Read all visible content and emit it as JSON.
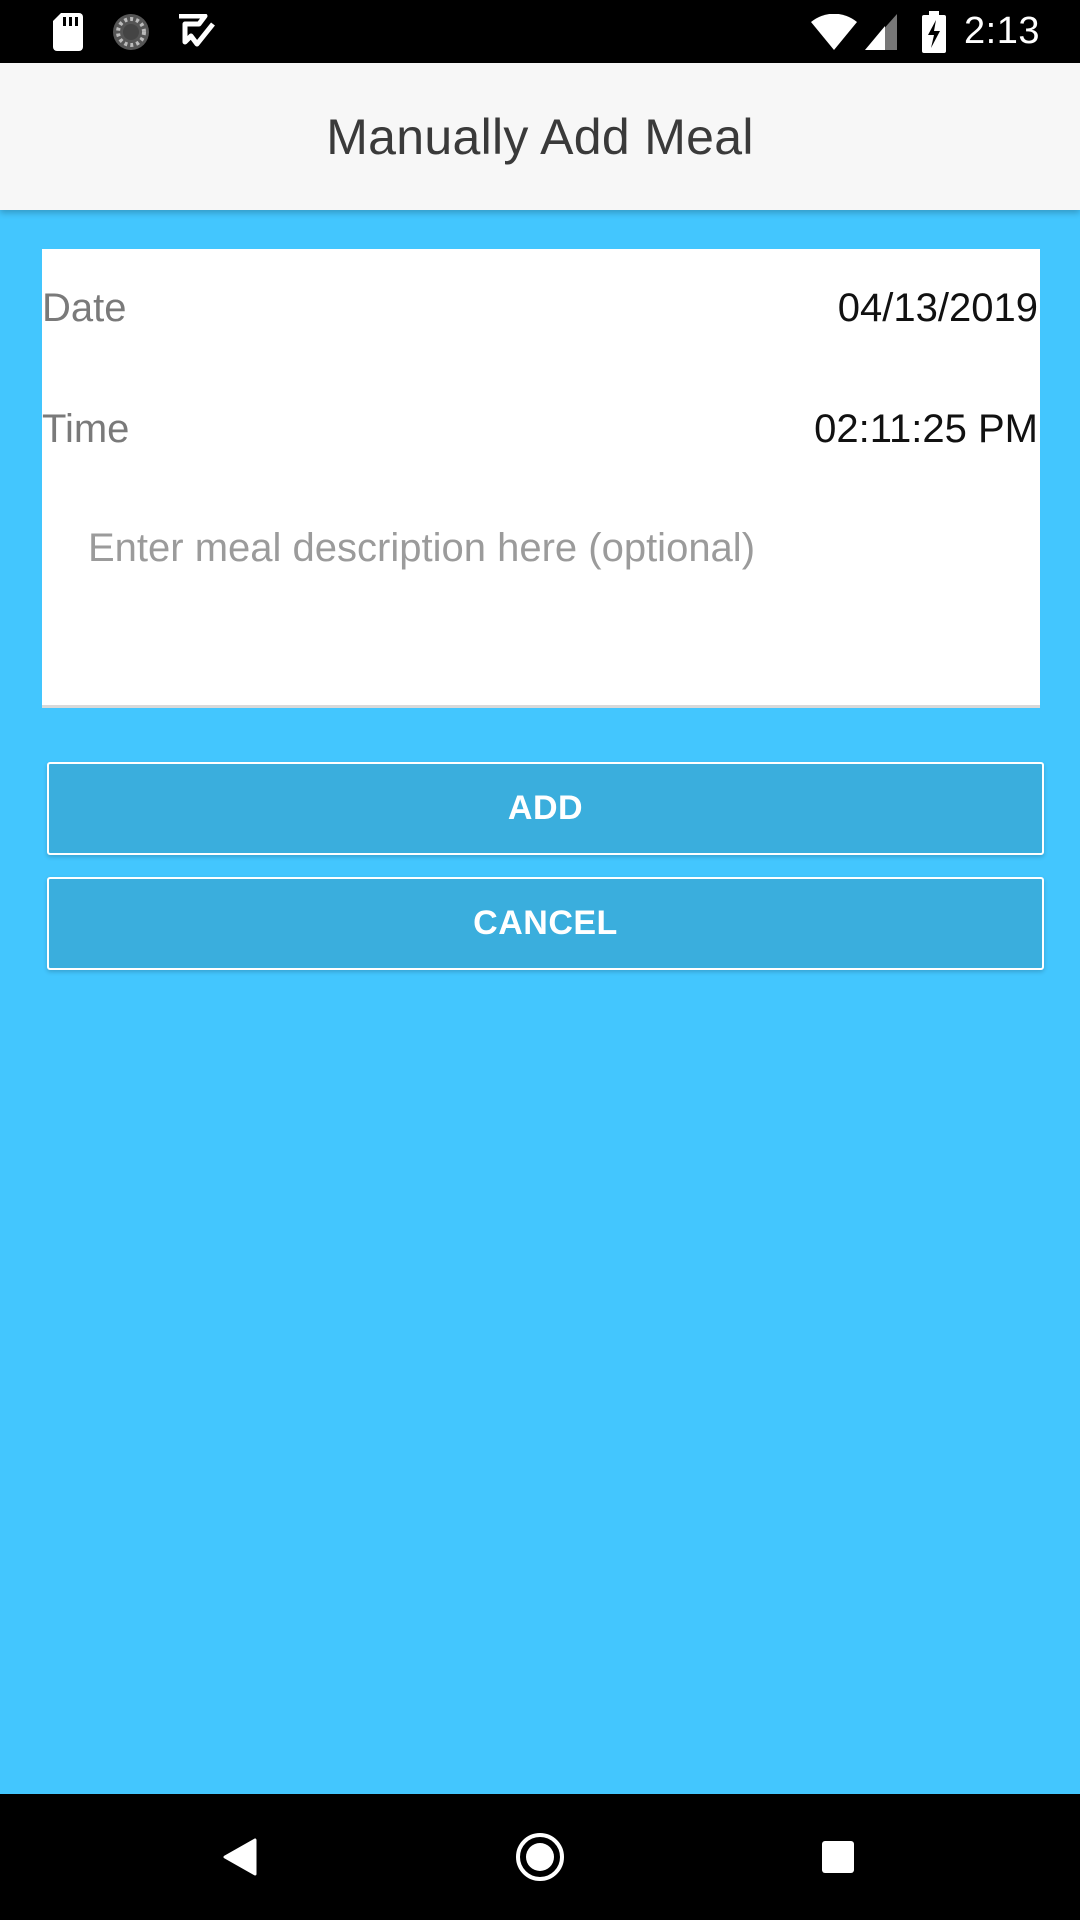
{
  "status_bar": {
    "time": "2:13",
    "left_icons": [
      "sd-card-icon",
      "sync-progress-icon",
      "check-app-icon"
    ],
    "right_icons": [
      "wifi-icon",
      "cell-signal-icon",
      "battery-charging-icon"
    ]
  },
  "app_bar": {
    "title": "Manually Add Meal"
  },
  "form": {
    "date_label": "Date",
    "date_value": "04/13/2019",
    "time_label": "Time",
    "time_value": "02:11:25 PM",
    "description_placeholder": "Enter meal description here (optional)",
    "description_value": ""
  },
  "actions": {
    "add_label": "ADD",
    "cancel_label": "CANCEL"
  },
  "nav_bar": {
    "buttons": [
      "back-icon",
      "home-icon",
      "recents-icon"
    ]
  },
  "colors": {
    "background": "#43c6fe",
    "button": "#3aaedd",
    "app_bar": "#f7f7f7",
    "title_text": "#3a3a3a"
  }
}
